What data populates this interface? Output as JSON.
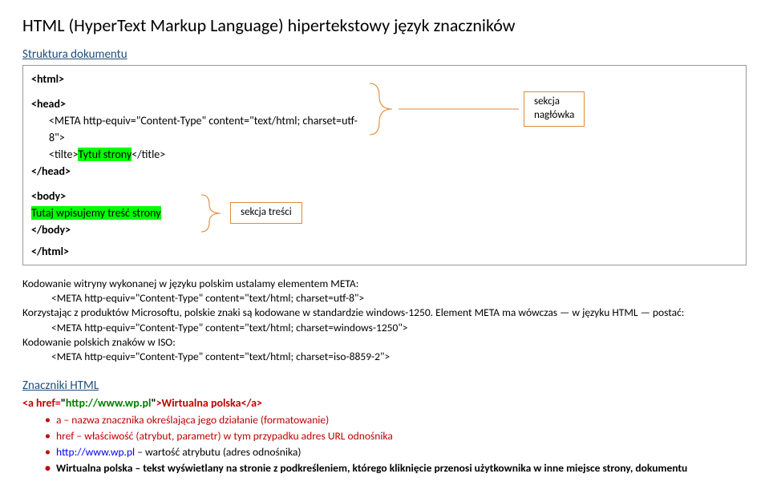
{
  "title": "HTML (HyperText Markup Language) hipertekstowy język znaczników",
  "struct_header": "Struktura dokumentu",
  "code": {
    "html_open": "<html>",
    "head_open": "<head>",
    "meta": "<META http-equiv=\"Content-Type\" content=\"text/html; charset=utf-8\">",
    "title_open": "<tilte>",
    "title_text": "Tytuł strony",
    "title_close": "</title>",
    "head_close": "</head>",
    "body_open": "<body>",
    "body_text": "Tutaj wpisujemy treść strony",
    "body_close": "</body>",
    "html_close": "</html>"
  },
  "callout_head1": "sekcja",
  "callout_head2": "nagłówka",
  "callout_body": "sekcja treści",
  "explain": {
    "l1": "Kodowanie witryny wykonanej w języku polskim ustalamy elementem META:",
    "l2": "<META http-equiv=\"Content-Type\" content=\"text/html; charset=utf-8\">",
    "l3": "Korzystając z produktów Microsoftu, polskie znaki są kodowane w standardzie windows-1250. Element META ma wówczas — w języku HTML — postać:",
    "l4": "<META http-equiv=\"Content-Type\" content=\"text/html; charset=windows-1250\">",
    "l5": "Kodowanie polskich znaków w ISO:",
    "l6": "<META http-equiv=\"Content-Type\" content=\"text/html; charset=iso-8859-2\">"
  },
  "znaczniki_header": "Znaczniki HTML",
  "link_line1": "<a href=",
  "link_line2": "\"",
  "link_url": "http://www.wp.pl",
  "link_line3": "\"",
  "link_line4": ">Wirtualna polska</a>",
  "bullets": {
    "b1": "a – nazwa znacznika określająca jego działanie (formatowanie)",
    "b2": "href – właściwość (atrybut, parametr) w tym przypadku adres URL odnośnika",
    "b3a": "http://www.wp.pl",
    "b3b": " – wartość atrybutu (adres odnośnika)",
    "b4": "Wirtualna polska – tekst wyświetlany na stronie z podkreśleniem, którego kliknięcie przenosi użytkownika w inne miejsce strony, dokumentu"
  }
}
